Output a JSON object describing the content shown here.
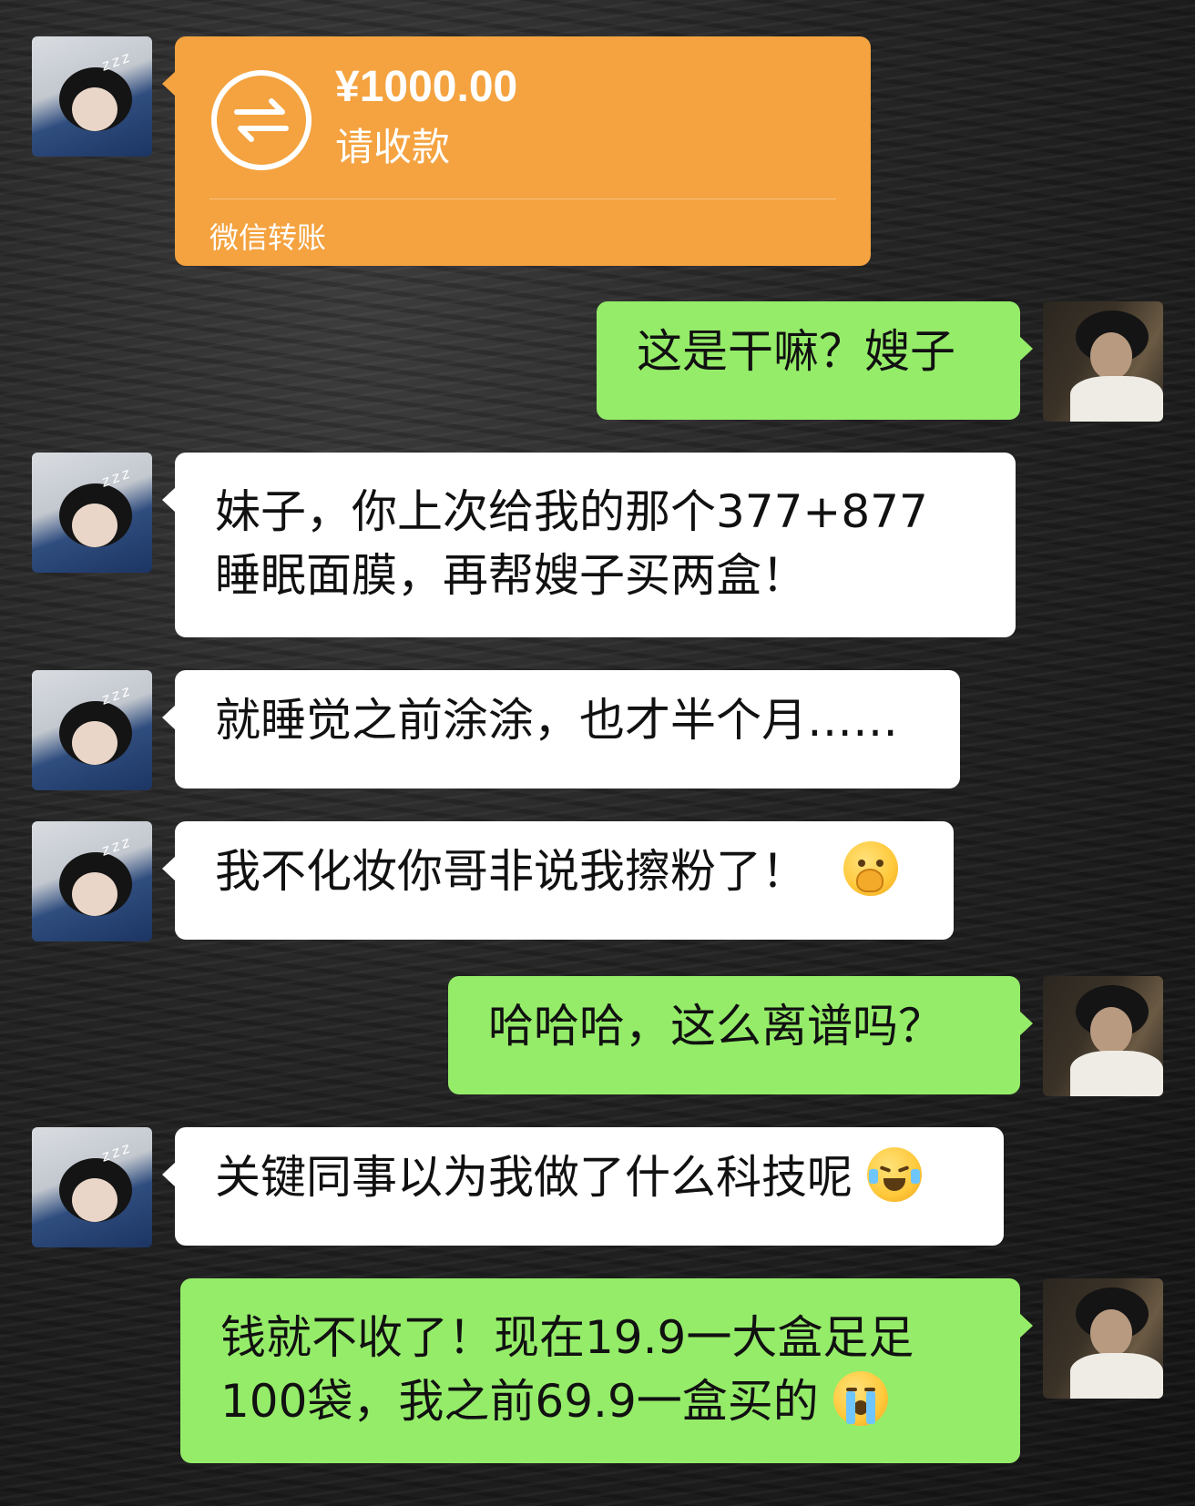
{
  "messages": [
    {
      "sender": "her",
      "type": "transfer",
      "amount": "¥1000.00",
      "note": "请收款",
      "label": "微信转账",
      "icon": "transfer-arrows-icon",
      "color": "#f4a340"
    },
    {
      "sender": "me",
      "type": "text",
      "lines": [
        "这是干嘛？嫂子"
      ]
    },
    {
      "sender": "her",
      "type": "text",
      "lines": [
        "妹子，你上次给我的那个377+877",
        "睡眠面膜，再帮嫂子买两盒！"
      ]
    },
    {
      "sender": "her",
      "type": "text",
      "lines": [
        "就睡觉之前涂涂，也才半个月……"
      ]
    },
    {
      "sender": "her",
      "type": "text",
      "lines": [
        "我不化妆你哥非说我擦粉了！"
      ],
      "emoji": "covering-mouth-laugh-emoji"
    },
    {
      "sender": "me",
      "type": "text",
      "lines": [
        "哈哈哈，这么离谱吗？"
      ]
    },
    {
      "sender": "her",
      "type": "text",
      "lines": [
        "关键同事以为我做了什么科技呢"
      ],
      "emoji": "crying-laughing-emoji"
    },
    {
      "sender": "me",
      "type": "text",
      "lines": [
        "钱就不收了！现在19.9一大盒足足",
        "100袋，我之前69.9一盒买的"
      ],
      "emoji": "loudly-crying-emoji"
    }
  ],
  "colors": {
    "outgoing_bubble": "#95ec69",
    "incoming_bubble": "#ffffff",
    "transfer_card": "#f4a340"
  },
  "avatars": {
    "her": "sleeping-girl-avatar",
    "me": "boy-in-dark-room-avatar"
  }
}
